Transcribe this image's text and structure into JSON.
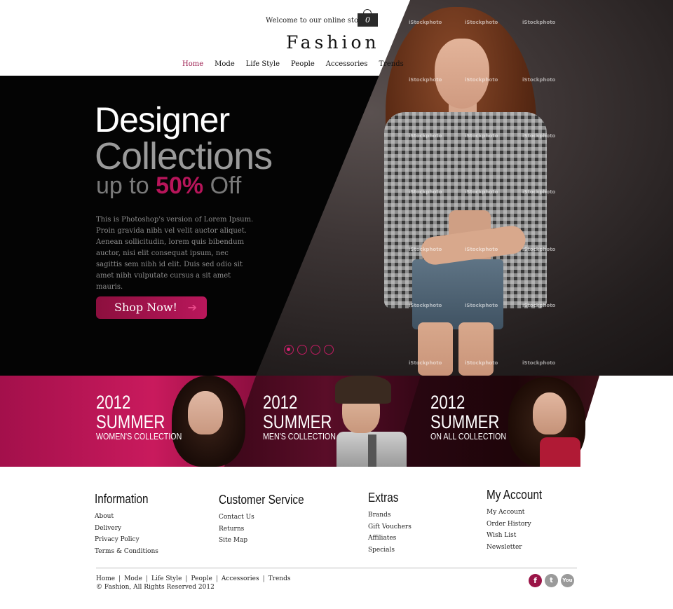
{
  "header": {
    "welcome": "Welcome to our online store!",
    "cart_count": "0",
    "logo": "Fashion",
    "nav": [
      "Home",
      "Mode",
      "Life Style",
      "People",
      "Accessories",
      "Trends"
    ]
  },
  "hero": {
    "line1": "Designer",
    "line2": "Collections",
    "line3_pre": "up to ",
    "line3_highlight": "50%",
    "line3_post": " Off",
    "body": "This is Photoshop's version  of Lorem Ipsum. Proin gravida nibh vel velit auctor aliquet. Aenean sollicitudin, lorem quis bibendum auctor, nisi elit consequat ipsum, nec sagittis sem nibh id elit. Duis sed odio sit amet nibh vulputate cursus a sit amet mauris.",
    "cta": "Shop Now!",
    "slides": {
      "count": 4,
      "active": 1
    },
    "watermark": "iStockphoto"
  },
  "banners": [
    {
      "year": "2012",
      "title": "SUMMER",
      "subtitle": "WOMEN'S COLLECTION"
    },
    {
      "year": "2012",
      "title": "SUMMER",
      "subtitle": "MEN'S COLLECTION"
    },
    {
      "year": "2012",
      "title": "SUMMER",
      "subtitle": "ON ALL COLLECTION"
    }
  ],
  "footer": {
    "columns": [
      {
        "title": "Information",
        "links": [
          "About",
          "Delivery",
          "Privacy Policy",
          "Terms & Conditions"
        ]
      },
      {
        "title": "Customer Service",
        "links": [
          "Contact Us",
          "Returns",
          "Site Map"
        ]
      },
      {
        "title": "Extras",
        "links": [
          "Brands",
          "Gift Vouchers",
          "Affiliates",
          "Specials"
        ]
      },
      {
        "title": "My Account",
        "links": [
          "My Account",
          "Order History",
          "Wish List",
          "Newsletter"
        ]
      }
    ],
    "nav": [
      "Home",
      "Mode",
      "Life Style",
      "People",
      "Accessories",
      "Trends"
    ],
    "copyright": "© Fashion, All Rights Reserved 2012",
    "social": [
      {
        "name": "facebook-icon",
        "glyph": "f"
      },
      {
        "name": "twitter-icon",
        "glyph": "t"
      },
      {
        "name": "youtube-icon",
        "glyph": "You"
      }
    ]
  },
  "colors": {
    "accent": "#b7155a",
    "dark": "#040404"
  }
}
